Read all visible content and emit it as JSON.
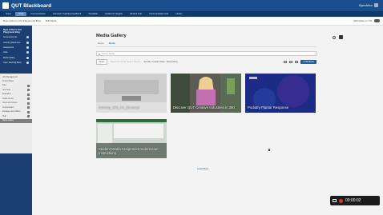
{
  "header": {
    "brand": "QUT Blackboard",
    "user": "Ryan Arthur"
  },
  "nav": {
    "tabs": [
      "Home",
      "Units",
      "Communication",
      "Unit Hub: Teaching Feedback",
      "Timetable",
      "Academic Integrity",
      "Student Hub",
      "Communication Hub",
      "Library"
    ],
    "active": 1
  },
  "breadcrumb": {
    "path": "Ryan Arthur's Unit Playground Blog",
    "second": "Edit Mode",
    "toggle_label": "Edit Mode is: ON"
  },
  "sidebar": {
    "section_title": "Ryan Arthur's Unit Playground Blog",
    "items": [
      "Announcements",
      "Learning Resources",
      "Assessment",
      "Units",
      "Media Gallery",
      "Open Teaching Block"
    ],
    "gray_title": "Unit Management",
    "gray_sub": "Control Panel",
    "gray_items": [
      "Files",
      "Unit Tools",
      "Evaluation",
      "Grade Centre",
      "Users and Groups",
      "Customisation",
      "Packages and Utilities",
      "Help"
    ],
    "gray_active": "Media Gallery"
  },
  "main": {
    "title": "Media Gallery",
    "tabs": [
      "Home",
      "Media"
    ],
    "active_tab": 1,
    "search_placeholder": "Search Media",
    "filters_label": "Filters",
    "filter_hint": "Search In: All (0) Search Results",
    "sort_label": "Sort By: Creation Date - Descending",
    "add_media": "+ Add Media",
    "load_more": "Load More",
    "cards": [
      {
        "title": "Nursing_360_4K_(Source)",
        "bg": "#d4d4d4",
        "fg": "#ffffff"
      },
      {
        "title": "Discover QUT Creative Industries in 360",
        "bg": "#6a6460",
        "fg": "#ffffff"
      },
      {
        "title": "Podiatry Plantar Response",
        "bg": "#1f2f8a",
        "fg": "#ffffff"
      },
      {
        "title": "Student Media Assignment Submission Instructions",
        "bg": "#2d5e38",
        "fg": "#ffffff"
      }
    ]
  },
  "recorder": {
    "time": "00:00:02"
  }
}
